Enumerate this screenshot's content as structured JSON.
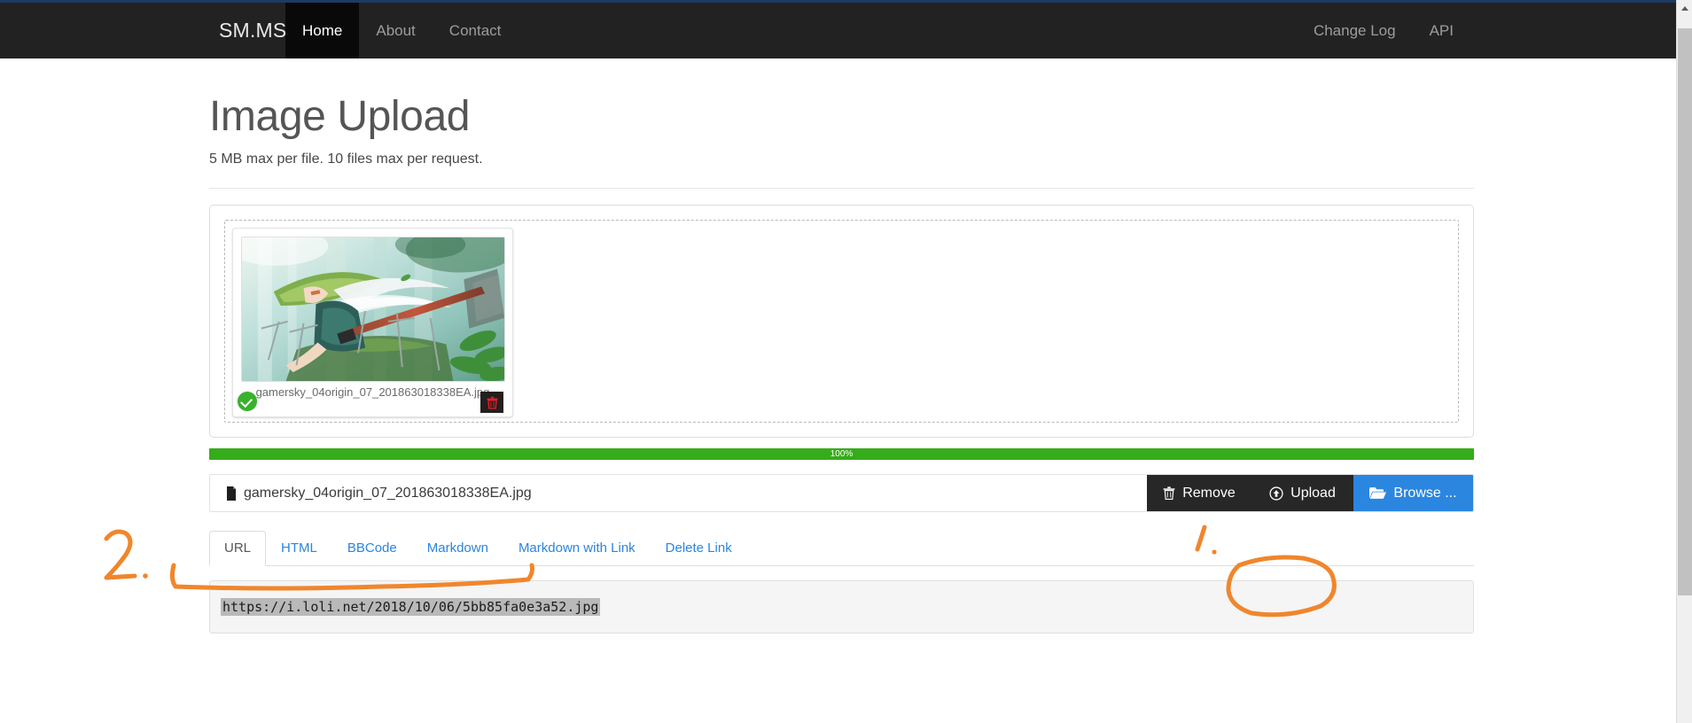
{
  "navbar": {
    "brand": "SM.MS",
    "left_items": [
      {
        "label": "Home",
        "active": true
      },
      {
        "label": "About",
        "active": false
      },
      {
        "label": "Contact",
        "active": false
      }
    ],
    "right_items": [
      {
        "label": "Change Log"
      },
      {
        "label": "API"
      }
    ],
    "background_color": "#222222",
    "active_background_color": "#090909"
  },
  "page": {
    "title": "Image Upload",
    "subtitle": "5 MB max per file. 10 files max per request."
  },
  "upload": {
    "thumbnail": {
      "filename": "gamersky_04origin_07_201863018338EA.jpg",
      "status_icon": "success-check-icon",
      "status_color": "#38b22b",
      "delete_icon": "trash-icon",
      "delete_icon_color": "#ee1c25"
    },
    "progress": {
      "percent_label": "100%",
      "percent_value": 100,
      "bar_color": "#36ac1a"
    },
    "file_input": {
      "file_icon": "file-icon",
      "filename": "gamersky_04origin_07_201863018338EA.jpg"
    },
    "buttons": {
      "remove": {
        "label": "Remove",
        "icon": "trash-icon"
      },
      "upload": {
        "label": "Upload",
        "icon": "upload-circle-icon"
      },
      "browse": {
        "label": "Browse ...",
        "icon": "folder-open-icon",
        "color": "#2b86e0"
      }
    }
  },
  "tabs": [
    {
      "label": "URL",
      "active": true
    },
    {
      "label": "HTML",
      "active": false
    },
    {
      "label": "BBCode",
      "active": false
    },
    {
      "label": "Markdown",
      "active": false
    },
    {
      "label": "Markdown with Link",
      "active": false
    },
    {
      "label": "Delete Link",
      "active": false
    }
  ],
  "result": {
    "url": "https://i.loli.net/2018/10/06/5bb85fa0e3a52.jpg",
    "selected": true
  },
  "annotations": {
    "color": "#f0862c",
    "marks": [
      {
        "name": "step-1-label",
        "text": "1.",
        "target": "upload-button"
      },
      {
        "name": "upload-button-circle",
        "text": "",
        "target": "upload-button"
      },
      {
        "name": "step-2-label",
        "text": "2.",
        "target": "result-url"
      },
      {
        "name": "result-url-underline",
        "text": "",
        "target": "result-url"
      }
    ]
  },
  "scrollbar": {
    "up_arrow_icon": "caret-up-icon",
    "thumb_color": "#c1c1c1",
    "track_color": "#f0f0f0"
  }
}
